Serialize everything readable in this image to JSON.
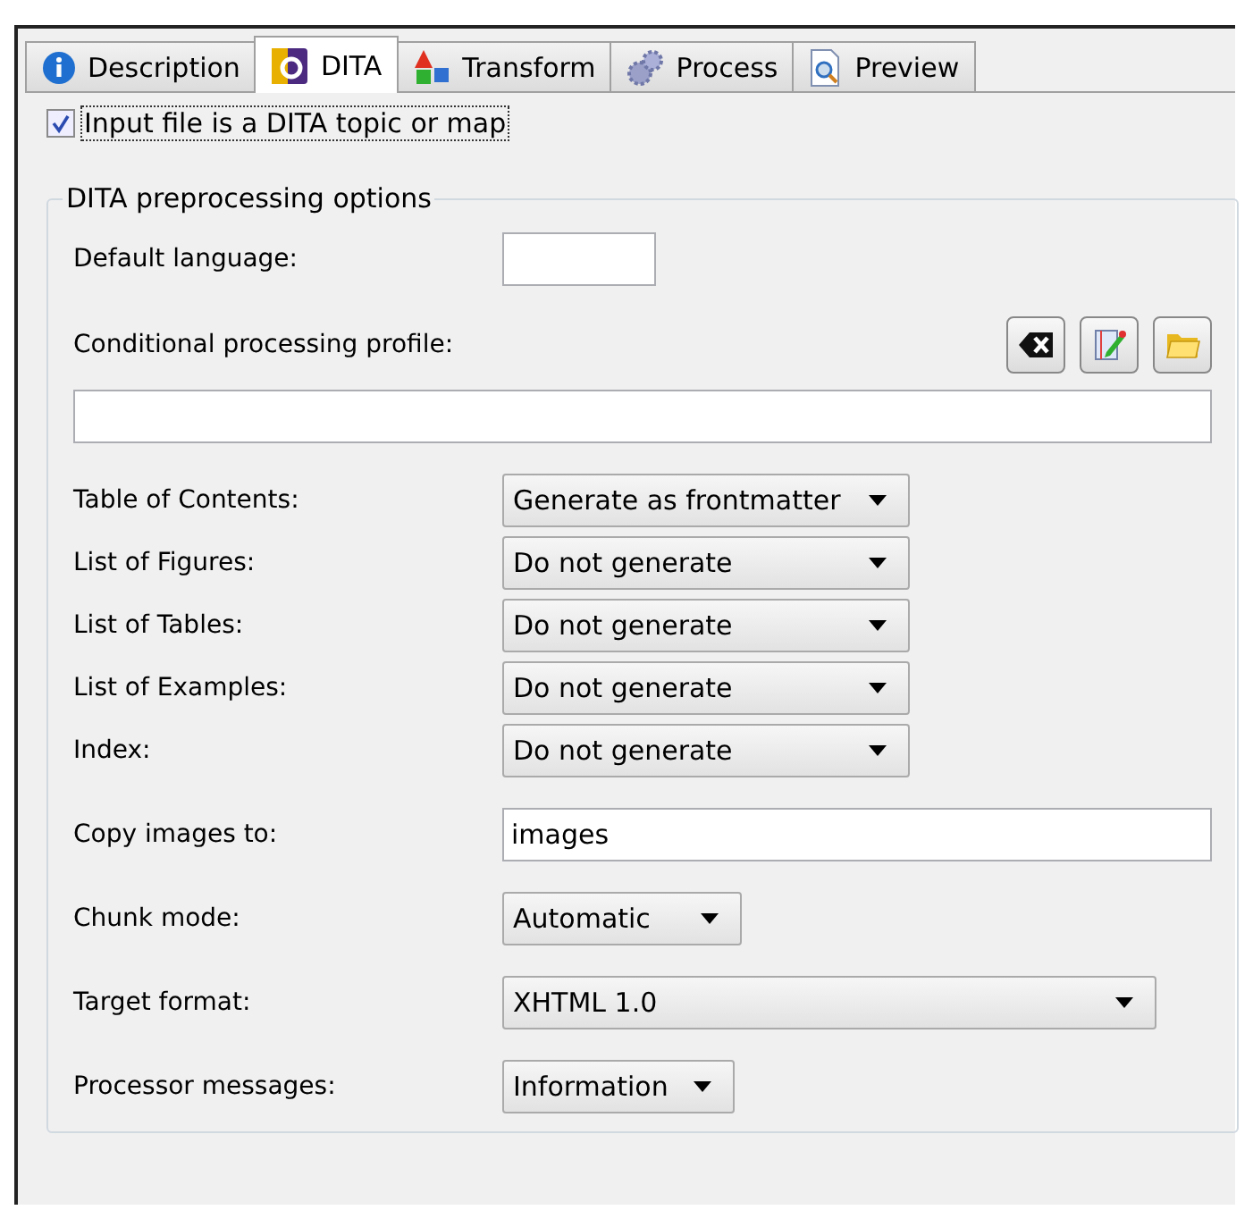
{
  "tabs": [
    {
      "label": "Description",
      "selected": false
    },
    {
      "label": "DITA",
      "selected": true
    },
    {
      "label": "Transform",
      "selected": false
    },
    {
      "label": "Process",
      "selected": false
    },
    {
      "label": "Preview",
      "selected": false
    }
  ],
  "input_checkbox": {
    "label": "Input file is a DITA topic or map",
    "checked": true
  },
  "group": {
    "title": "DITA preprocessing options",
    "sections": [
      [
        {
          "kind": "text",
          "label": "Default language:"
        }
      ],
      [
        {
          "kind": "profile",
          "label": "Conditional processing profile:"
        }
      ],
      [
        {
          "kind": "combo",
          "label": "Table of Contents:",
          "value": "Generate as frontmatter"
        },
        {
          "kind": "combo",
          "label": "List of Figures:",
          "value": "Do not generate"
        },
        {
          "kind": "combo",
          "label": "List of Tables:",
          "value": "Do not generate"
        },
        {
          "kind": "combo",
          "label": "List of Examples:",
          "value": "Do not generate"
        },
        {
          "kind": "combo",
          "label": "Index:",
          "value": "Do not generate"
        }
      ],
      [
        {
          "kind": "text",
          "label": "Copy images to:",
          "value": "images"
        }
      ],
      [
        {
          "kind": "combo",
          "label": "Chunk mode:",
          "value": "Automatic"
        }
      ],
      [
        {
          "kind": "combo",
          "label": "Target format:",
          "value": "XHTML 1.0"
        }
      ],
      [
        {
          "kind": "combo",
          "label": "Processor messages:",
          "value": "Information"
        }
      ]
    ]
  }
}
